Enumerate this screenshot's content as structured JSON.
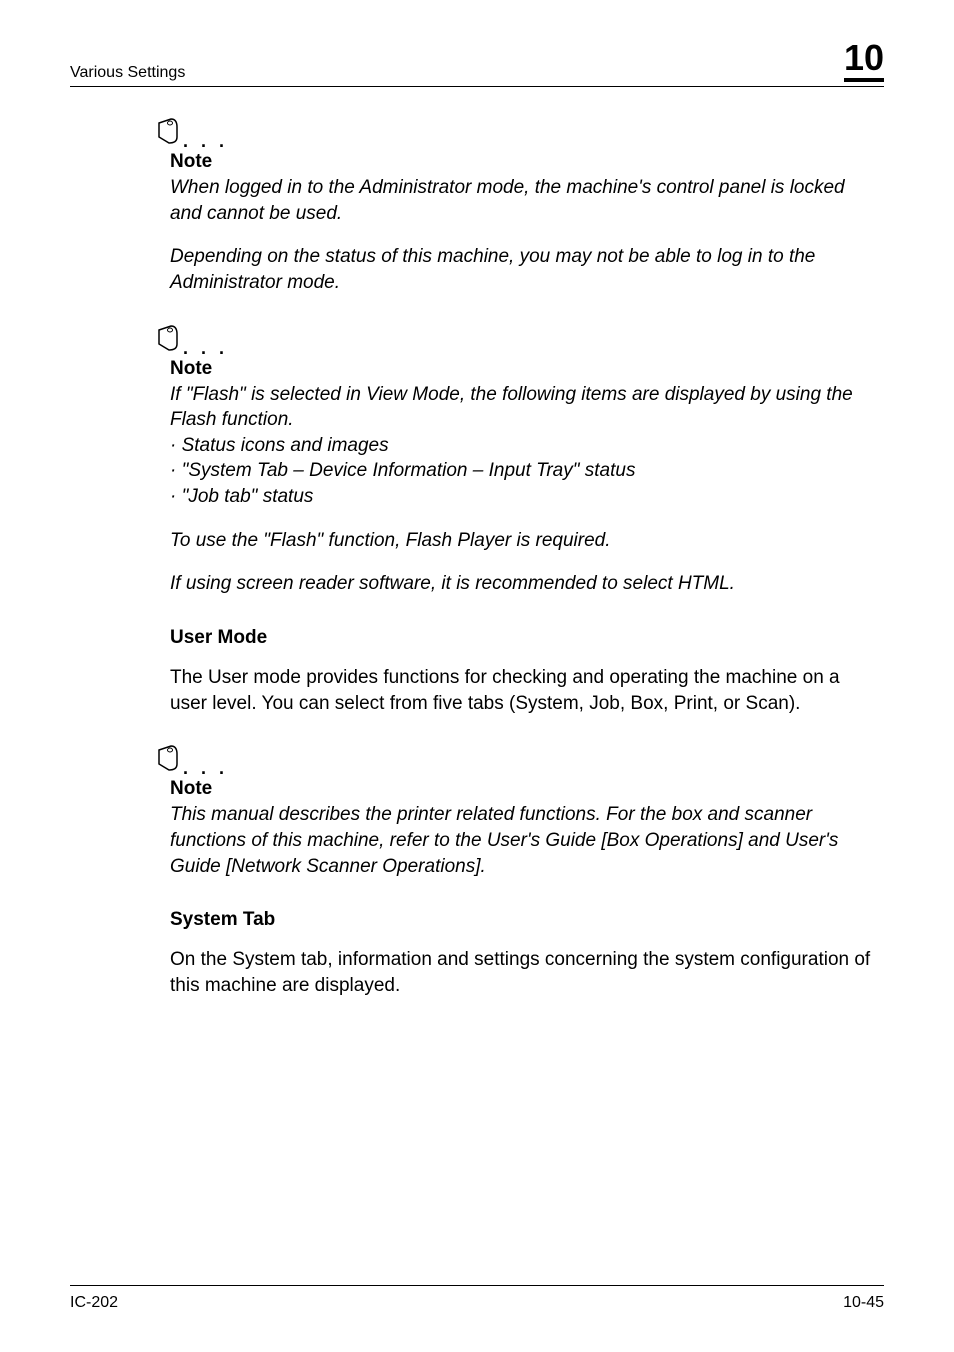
{
  "header": {
    "left": "Various Settings",
    "right": "10"
  },
  "note1": {
    "label": "Note",
    "p1": "When logged in to the Administrator mode, the machine's control panel is locked and cannot be used.",
    "p2": "Depending on the status of this machine, you may not be able to log in to the Administrator mode."
  },
  "note2": {
    "label": "Note",
    "p1": "If \"Flash\" is selected in View Mode, the following items are displayed by using the Flash function.",
    "b1": "· Status icons and images",
    "b2": "· \"System Tab – Device Information – Input Tray\" status",
    "b3": "· \"Job tab\" status",
    "p2": "To use the \"Flash\" function, Flash Player is required.",
    "p3": "If using screen reader software, it is recommended to select HTML."
  },
  "userMode": {
    "heading": "User Mode",
    "body": "The User mode provides functions for checking and operating the machine on a user level. You can select from five tabs (System, Job, Box, Print, or Scan)."
  },
  "note3": {
    "label": "Note",
    "p1": "This manual describes the printer related functions. For the box and scanner functions of this machine, refer to the User's Guide [Box Operations] and User's Guide [Network Scanner Operations]."
  },
  "systemTab": {
    "heading": "System Tab",
    "body": "On the System tab, information and settings concerning the system configuration of this machine are displayed."
  },
  "footer": {
    "left": "IC-202",
    "right": "10-45"
  }
}
